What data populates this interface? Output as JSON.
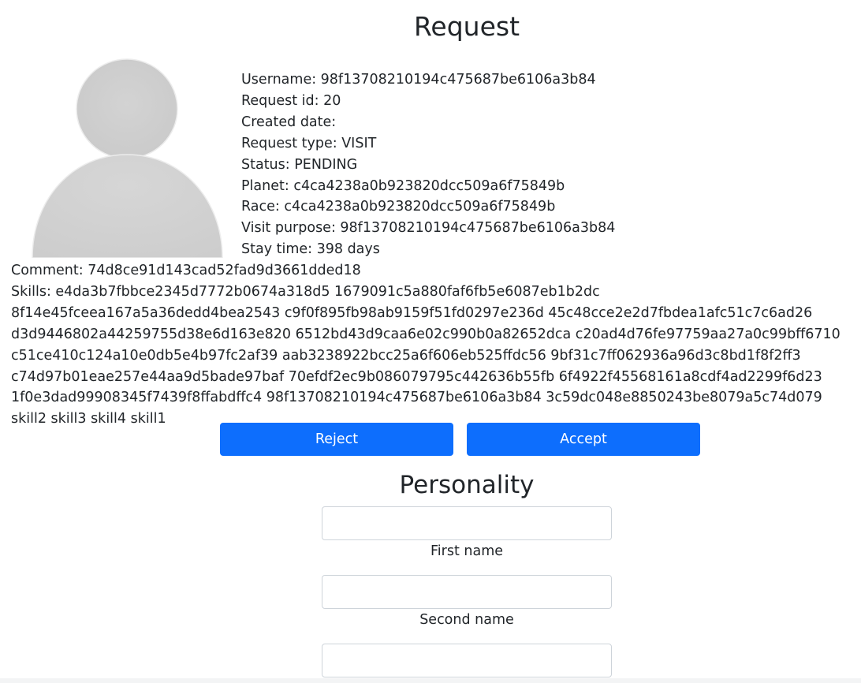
{
  "request": {
    "title": "Request",
    "avatar_icon": "user-placeholder-icon",
    "username": "Username: 98f13708210194c475687be6106a3b84",
    "request_id": "Request id: 20",
    "created_date": "Created date:",
    "request_type": "Request type: VISIT",
    "status": "Status: PENDING",
    "planet": "Planet: c4ca4238a0b923820dcc509a6f75849b",
    "race": "Race: c4ca4238a0b923820dcc509a6f75849b",
    "visit_purpose": "Visit purpose: 98f13708210194c475687be6106a3b84",
    "stay_time": "Stay time: 398 days",
    "comment": "Comment: 74d8ce91d143cad52fad9d3661dded18",
    "skills": "Skills: e4da3b7fbbce2345d7772b0674a318d5 1679091c5a880faf6fb5e6087eb1b2dc 8f14e45fceea167a5a36dedd4bea2543 c9f0f895fb98ab9159f51fd0297e236d 45c48cce2e2d7fbdea1afc51c7c6ad26 d3d9446802a44259755d38e6d163e820 6512bd43d9caa6e02c990b0a82652dca c20ad4d76fe97759aa27a0c99bff6710 c51ce410c124a10e0db5e4b97fc2af39 aab3238922bcc25a6f606eb525ffdc56 9bf31c7ff062936a96d3c8bd1f8f2ff3 c74d97b01eae257e44aa9d5bade97baf 70efdf2ec9b086079795c442636b55fb 6f4922f45568161a8cdf4ad2299f6d23 1f0e3dad99908345f7439f8ffabdffc4 98f13708210194c475687be6106a3b84 3c59dc048e8850243be8079a5c74d079 skill2 skill3 skill4 skill1"
  },
  "actions": {
    "reject_label": "Reject",
    "accept_label": "Accept",
    "button_color": "#0d6efd"
  },
  "personality": {
    "title": "Personality",
    "first_name_value": "",
    "first_name_label": "First name",
    "second_name_value": "",
    "second_name_label": "Second name",
    "third_field_value": ""
  }
}
